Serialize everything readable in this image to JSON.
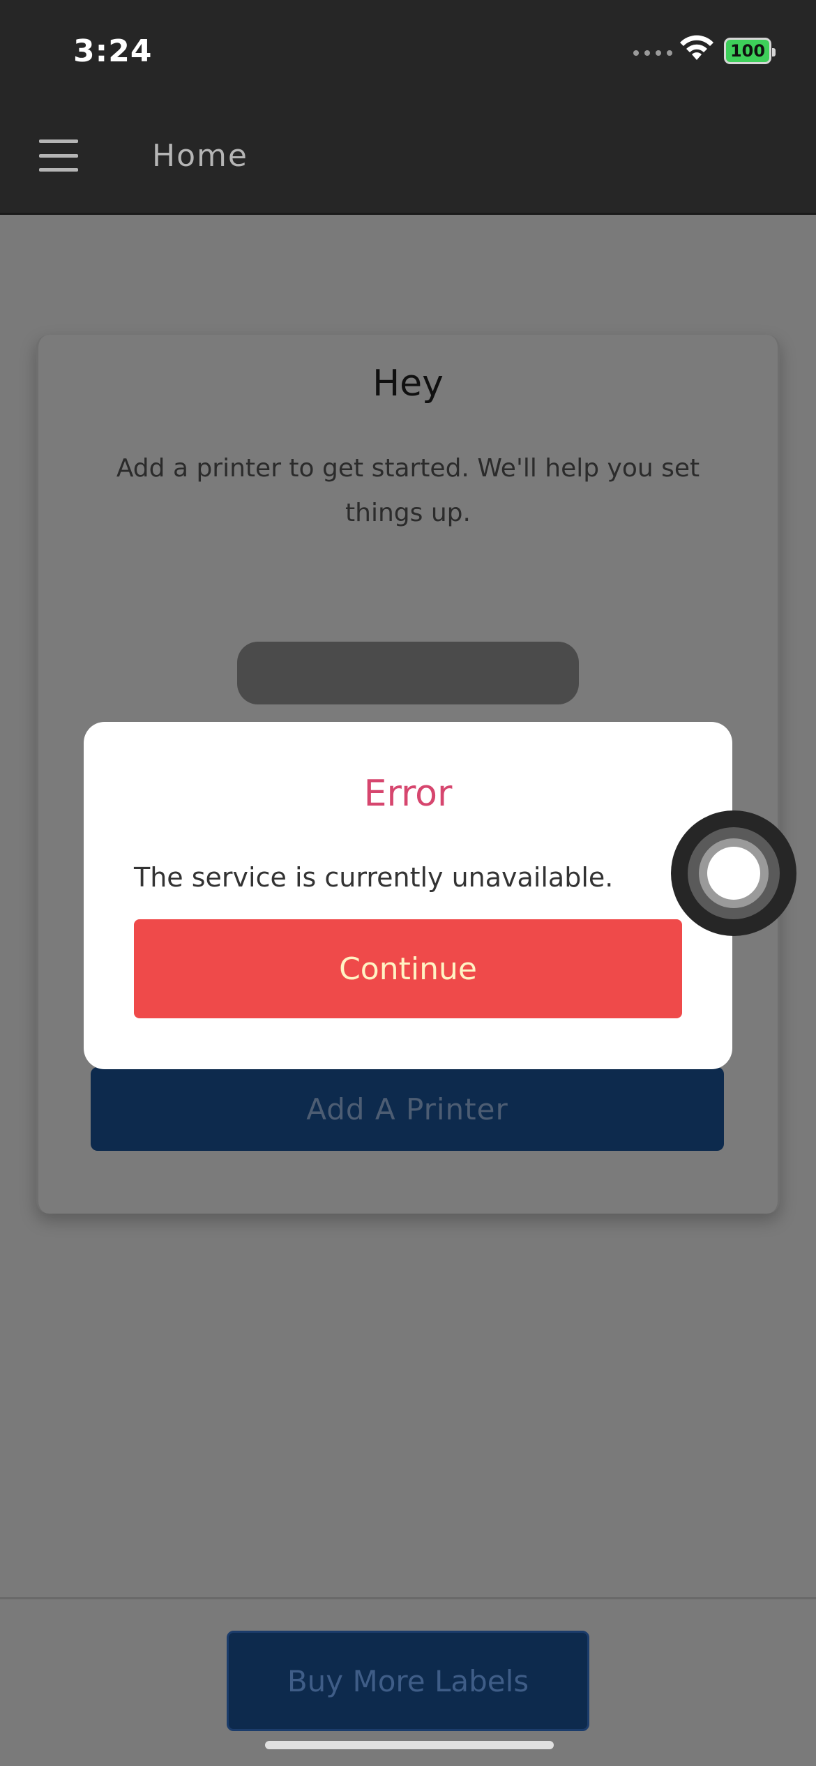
{
  "status_bar": {
    "time": "3:24",
    "battery_level": "100",
    "icons": [
      "signal-dots-icon",
      "wifi-icon",
      "battery-icon"
    ]
  },
  "navbar": {
    "title": "Home",
    "menu_icon": "hamburger-menu-icon"
  },
  "card": {
    "title": "Hey",
    "message": "Add a printer to get started. We'll help you set things up.",
    "add_printer_label": "Add A Printer"
  },
  "footer": {
    "buy_labels_label": "Buy More Labels"
  },
  "modal": {
    "title": "Error",
    "message": "The service is currently unavailable.",
    "continue_label": "Continue"
  },
  "colors": {
    "modal_title": "#d6466e",
    "continue_button": "#ef4a4a",
    "primary_button": "#0d2a4d",
    "navbar": "#262626"
  }
}
